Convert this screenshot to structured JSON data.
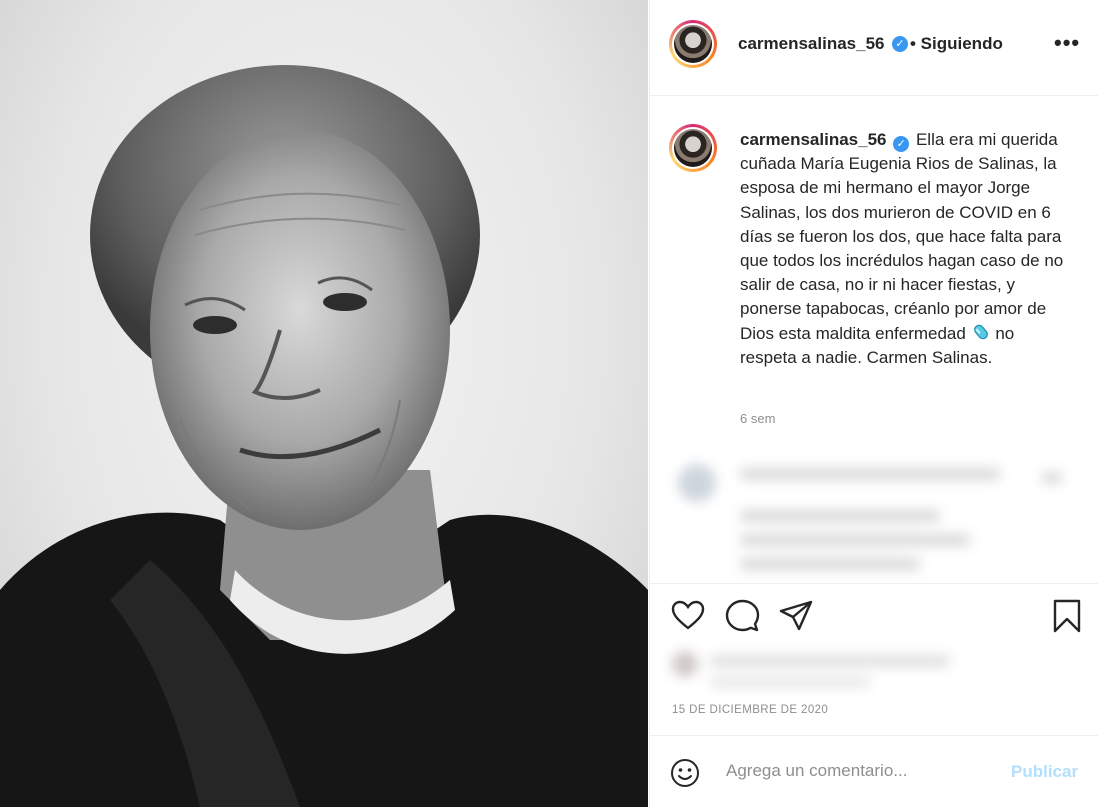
{
  "post": {
    "username": "carmensalinas_56",
    "follow_status": "• Siguiendo",
    "more_icon": "more-horizontal-icon",
    "caption": {
      "username": "carmensalinas_56",
      "text_before_emoji": "Ella era mi querida cuñada María Eugenia Rios de Salinas, la esposa de mi hermano el mayor Jorge Salinas, los dos murieron de COVID en 6 días se fueron los dos, que hace falta para que todos los incrédulos hagan caso de no salir de casa, no ir ni hacer fiestas, y ponerse tapabocas, créanlo por amor de Dios esta maldita enfermedad",
      "emoji": "pill-icon",
      "text_after_emoji": "no respeta a nadie. Carmen Salinas."
    },
    "time_ago": "6 sem",
    "date": "15 DE DICIEMBRE DE 2020"
  },
  "actions": {
    "like": "heart-icon",
    "comment": "comment-icon",
    "share": "send-icon",
    "save": "bookmark-icon"
  },
  "comment_box": {
    "placeholder": "Agrega un comentario...",
    "publish_label": "Publicar"
  },
  "colors": {
    "verified": "#3897f0",
    "publish_disabled": "#b2dffc",
    "secondary_text": "#8e8e8e",
    "story_ring": [
      "#d62976",
      "#fa7e1e",
      "#feda75"
    ]
  }
}
